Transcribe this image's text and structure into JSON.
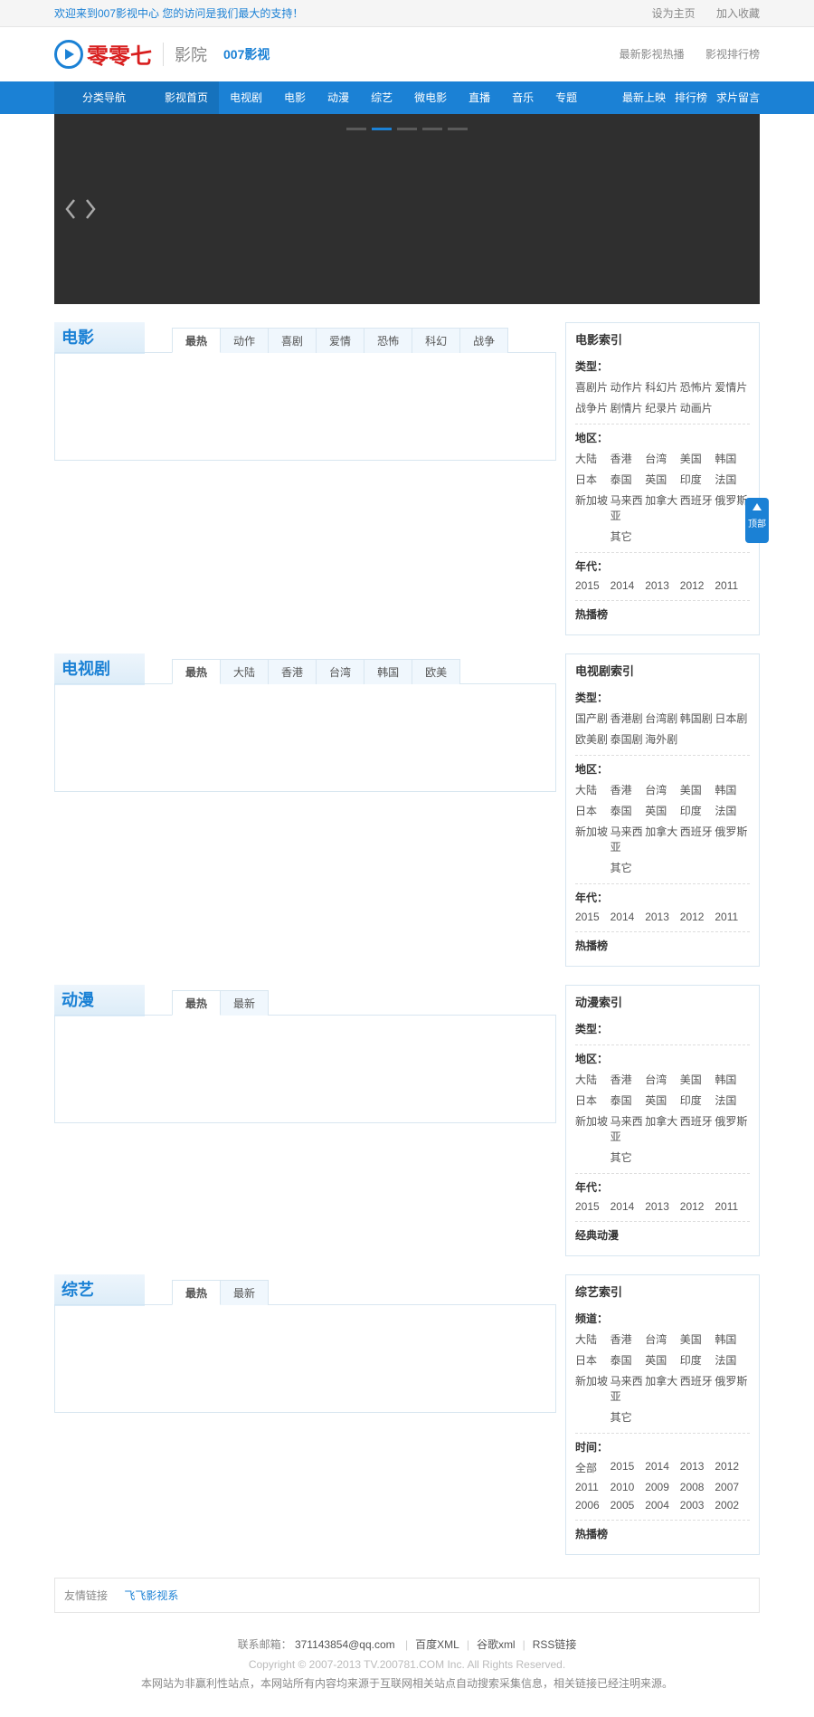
{
  "topbar": {
    "welcome": "欢迎来到007影视中心 您的访问是我们最大的支持！",
    "set_home": "设为主页",
    "add_fav": "加入收藏"
  },
  "header": {
    "logo_text": "零零七",
    "logo_sub": "影院",
    "brand": "007影视",
    "hot": "最新影视热播",
    "rank": "影视排行榜"
  },
  "nav": {
    "category": "分类导航",
    "items": [
      "影视首页",
      "电视剧",
      "电影",
      "动漫",
      "综艺",
      "微电影",
      "直播",
      "音乐",
      "专题"
    ],
    "right": [
      "最新上映",
      "排行榜",
      "求片留言"
    ]
  },
  "sections": [
    {
      "title": "电影",
      "tabs": [
        "最热",
        "动作",
        "喜剧",
        "爱情",
        "恐怖",
        "科幻",
        "战争"
      ],
      "side_title": "电影索引",
      "groups": [
        {
          "label": "类型：",
          "links": [
            "喜剧片",
            "动作片",
            "科幻片",
            "恐怖片",
            "爱情片",
            "战争片",
            "剧情片",
            "纪录片",
            "动画片"
          ]
        },
        {
          "label": "地区：",
          "links": [
            "大陆",
            "香港",
            "台湾",
            "美国",
            "韩国",
            "日本",
            "泰国",
            "英国",
            "印度",
            "法国",
            "新加坡",
            "马来西亚",
            "加拿大",
            "西班牙",
            "俄罗斯",
            "",
            "其它"
          ]
        },
        {
          "label": "年代：",
          "links": [
            "2015",
            "2014",
            "2013",
            "2012",
            "2011"
          ]
        }
      ],
      "hot": "热播榜"
    },
    {
      "title": "电视剧",
      "tabs": [
        "最热",
        "大陆",
        "香港",
        "台湾",
        "韩国",
        "欧美"
      ],
      "side_title": "电视剧索引",
      "groups": [
        {
          "label": "类型：",
          "links": [
            "国产剧",
            "香港剧",
            "台湾剧",
            "韩国剧",
            "日本剧",
            "欧美剧",
            "泰国剧",
            "海外剧"
          ]
        },
        {
          "label": "地区：",
          "links": [
            "大陆",
            "香港",
            "台湾",
            "美国",
            "韩国",
            "日本",
            "泰国",
            "英国",
            "印度",
            "法国",
            "新加坡",
            "马来西亚",
            "加拿大",
            "西班牙",
            "俄罗斯",
            "",
            "其它"
          ]
        },
        {
          "label": "年代：",
          "links": [
            "2015",
            "2014",
            "2013",
            "2012",
            "2011"
          ]
        }
      ],
      "hot": "热播榜"
    },
    {
      "title": "动漫",
      "tabs": [
        "最热",
        "最新"
      ],
      "side_title": "动漫索引",
      "groups": [
        {
          "label": "类型：",
          "links": []
        },
        {
          "label": "地区：",
          "links": [
            "大陆",
            "香港",
            "台湾",
            "美国",
            "韩国",
            "日本",
            "泰国",
            "英国",
            "印度",
            "法国",
            "新加坡",
            "马来西亚",
            "加拿大",
            "西班牙",
            "俄罗斯",
            "",
            "其它"
          ]
        },
        {
          "label": "年代：",
          "links": [
            "2015",
            "2014",
            "2013",
            "2012",
            "2011"
          ]
        }
      ],
      "hot": "经典动漫"
    },
    {
      "title": "综艺",
      "tabs": [
        "最热",
        "最新"
      ],
      "side_title": "综艺索引",
      "groups": [
        {
          "label": "频道：",
          "links": [
            "大陆",
            "香港",
            "台湾",
            "美国",
            "韩国",
            "日本",
            "泰国",
            "英国",
            "印度",
            "法国",
            "新加坡",
            "马来西亚",
            "加拿大",
            "西班牙",
            "俄罗斯",
            "",
            "其它"
          ]
        },
        {
          "label": "时间：",
          "links": [
            "全部",
            "2015",
            "2014",
            "2013",
            "2012",
            "2011",
            "2010",
            "2009",
            "2008",
            "2007",
            "2006",
            "2005",
            "2004",
            "2003",
            "2002"
          ]
        }
      ],
      "hot": "热播榜"
    }
  ],
  "friendlinks": {
    "label": "友情链接",
    "links": [
      "飞飞影视系"
    ]
  },
  "footer": {
    "contact_label": "联系邮箱：",
    "contact_email": "371143854@qq.com",
    "links": [
      "百度XML",
      "谷歌xml",
      "RSS链接"
    ],
    "copyright": "Copyright © 2007-2013 TV.200781.COM Inc. All Rights Reserved.",
    "disclaimer": "本网站为非赢利性站点，本网站所有内容均来源于互联网相关站点自动搜索采集信息，相关链接已经注明来源。"
  },
  "backtop": "顶部"
}
